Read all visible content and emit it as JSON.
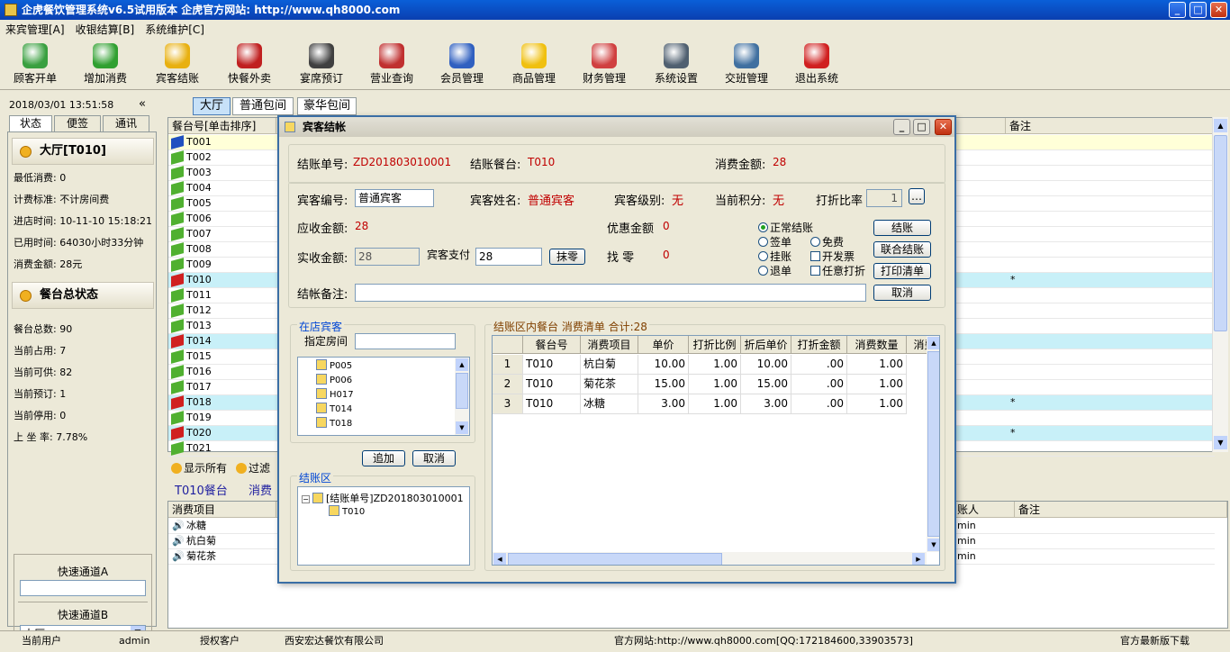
{
  "window": {
    "title": "企虎餐饮管理系统v6.5试用版本  企虎官方网站: http://www.qh8000.com"
  },
  "menu": [
    "来宾管理[A]",
    "收银结算[B]",
    "系统维护[C]"
  ],
  "toolbar": [
    {
      "label": "顾客开单",
      "icon": "person-icon",
      "color": "#3aa040"
    },
    {
      "label": "增加消费",
      "icon": "add-cart-icon",
      "color": "#30a030"
    },
    {
      "label": "宾客结账",
      "icon": "arrow-right-icon",
      "color": "#e8b010"
    },
    {
      "label": "快餐外卖",
      "icon": "bowl-icon",
      "color": "#c02020"
    },
    {
      "label": "宴席预订",
      "icon": "alarm-clock-icon",
      "color": "#404040"
    },
    {
      "label": "营业查询",
      "icon": "report-icon",
      "color": "#c03030"
    },
    {
      "label": "会员管理",
      "icon": "members-icon",
      "color": "#3060c0"
    },
    {
      "label": "商品管理",
      "icon": "star-icon",
      "color": "#f0c010"
    },
    {
      "label": "财务管理",
      "icon": "finance-icon",
      "color": "#d04040"
    },
    {
      "label": "系统设置",
      "icon": "settings-book-icon",
      "color": "#506070"
    },
    {
      "label": "交班管理",
      "icon": "handshake-icon",
      "color": "#4070a0"
    },
    {
      "label": "退出系统",
      "icon": "power-icon",
      "color": "#d02020"
    }
  ],
  "left": {
    "datetime": "2018/03/01  13:51:58",
    "collapse": "«",
    "tabs": [
      "状态",
      "便签",
      "通讯"
    ],
    "table_section": "大厅[T010]",
    "table_stats": [
      "最低消费: 0",
      "计费标准: 不计房间费",
      "进店时间: 10-11-10 15:18:21",
      "已用时间: 64030小时33分钟",
      "消费金额: 28元"
    ],
    "overall_section": "餐台总状态",
    "overall_stats": [
      "餐台总数: 90",
      "当前占用: 7",
      "当前可供: 82",
      "当前预订: 1",
      "当前停用: 0",
      "上 坐 率: 7.78%"
    ],
    "quick_a_label": "快速通道A",
    "quick_a_value": "",
    "quick_b_label": "快速通道B",
    "quick_b_value": "大厅"
  },
  "main": {
    "tabs": [
      "大厅",
      "普通包间",
      "豪华包间"
    ],
    "grid_header_left": "餐台号[单击排序]",
    "grid_header_right": "备注",
    "rows": [
      {
        "id": "T001",
        "status": "blue",
        "mark": ""
      },
      {
        "id": "T002",
        "status": "green",
        "mark": ""
      },
      {
        "id": "T003",
        "status": "green",
        "mark": ""
      },
      {
        "id": "T004",
        "status": "green",
        "mark": ""
      },
      {
        "id": "T005",
        "status": "green",
        "mark": ""
      },
      {
        "id": "T006",
        "status": "green",
        "mark": ""
      },
      {
        "id": "T007",
        "status": "green",
        "mark": ""
      },
      {
        "id": "T008",
        "status": "green",
        "mark": ""
      },
      {
        "id": "T009",
        "status": "green",
        "mark": ""
      },
      {
        "id": "T010",
        "status": "red",
        "mark": "*"
      },
      {
        "id": "T011",
        "status": "green",
        "mark": ""
      },
      {
        "id": "T012",
        "status": "green",
        "mark": ""
      },
      {
        "id": "T013",
        "status": "green",
        "mark": ""
      },
      {
        "id": "T014",
        "status": "red",
        "mark": ""
      },
      {
        "id": "T015",
        "status": "green",
        "mark": ""
      },
      {
        "id": "T016",
        "status": "green",
        "mark": ""
      },
      {
        "id": "T017",
        "status": "green",
        "mark": ""
      },
      {
        "id": "T018",
        "status": "red",
        "mark": "*"
      },
      {
        "id": "T019",
        "status": "green",
        "mark": ""
      },
      {
        "id": "T020",
        "status": "red",
        "mark": "*"
      },
      {
        "id": "T021",
        "status": "green",
        "mark": ""
      }
    ],
    "show_all": "显示所有",
    "filter": "过滤",
    "info_table": "T010餐台",
    "info_consume": "消费",
    "bottom_headers": {
      "item": "消费项目",
      "account": "账人",
      "note": "备注"
    },
    "bottom_items": [
      {
        "name": "冰糖",
        "user": "min"
      },
      {
        "name": "杭白菊",
        "user": "min"
      },
      {
        "name": "菊花茶",
        "user": "min"
      }
    ]
  },
  "status_bar": {
    "user_label": "当前用户",
    "user": "admin",
    "license_label": "授权客户",
    "company": "西安宏达餐饮有限公司",
    "site": "官方网站:http://www.qh8000.com[QQ:172184600,33903573]",
    "download": "官方最新版下载"
  },
  "dialog": {
    "title": "宾客结帐",
    "bill_no_label": "结账单号:",
    "bill_no": "ZD201803010001",
    "bill_table_label": "结账餐台:",
    "bill_table": "T010",
    "consume_label": "消费金额:",
    "consume": "28",
    "guest_no_label": "宾客编号:",
    "guest_no": "普通宾客",
    "guest_name_label": "宾客姓名:",
    "guest_name": "普通宾客",
    "guest_level_label": "宾客级别:",
    "guest_level": "无",
    "points_label": "当前积分:",
    "points": "无",
    "discount_label": "打折比率",
    "discount": "1",
    "more_btn": "…",
    "receivable_label": "应收金额:",
    "receivable": "28",
    "preferential_label": "优惠金额",
    "preferential": "0",
    "actual_label": "实收金额:",
    "actual": "28",
    "pay_label": "宾客支付",
    "pay": "28",
    "round_btn": "抹零",
    "change_label": "找    零",
    "change": "0",
    "radios": [
      {
        "label": "正常结账",
        "on": true
      },
      {
        "label": "签单",
        "on": false
      },
      {
        "label": "免费",
        "on": false
      },
      {
        "label": "挂账",
        "on": false
      },
      {
        "label": "退单",
        "on": false
      }
    ],
    "checks": [
      "开发票",
      "任意打折"
    ],
    "buttons": [
      "结账",
      "联合结账",
      "打印清单",
      "取消"
    ],
    "remark_label": "结帐备注:",
    "remark": "",
    "in_store_group": "在店宾客",
    "room_label": "指定房间",
    "room_value": "",
    "room_tree": [
      "P005",
      "P006",
      "H017",
      "T014",
      "T018"
    ],
    "add_btn": "追加",
    "cancel_btn": "取消",
    "checkout_group": "结账区",
    "checkout_root": "[结账单号]ZD201803010001",
    "checkout_child": "T010",
    "list_group": "结账区内餐台  消费清单  合计:28",
    "list_headers": [
      "餐台号",
      "消费项目",
      "单价",
      "打折比例",
      "折后单价",
      "打折金额",
      "消费数量",
      "消费"
    ],
    "list_rows": [
      {
        "no": "1",
        "table": "T010",
        "item": "杭白菊",
        "price": "10.00",
        "rate": "1.00",
        "after": "10.00",
        "disc": ".00",
        "qty": "1.00"
      },
      {
        "no": "2",
        "table": "T010",
        "item": "菊花茶",
        "price": "15.00",
        "rate": "1.00",
        "after": "15.00",
        "disc": ".00",
        "qty": "1.00"
      },
      {
        "no": "3",
        "table": "T010",
        "item": "冰糖",
        "price": "3.00",
        "rate": "1.00",
        "after": "3.00",
        "disc": ".00",
        "qty": "1.00"
      }
    ]
  },
  "colors": {
    "selected_row": "#c8f0f8",
    "first_row": "#ffffd8",
    "accent": "#0a3fb0"
  }
}
